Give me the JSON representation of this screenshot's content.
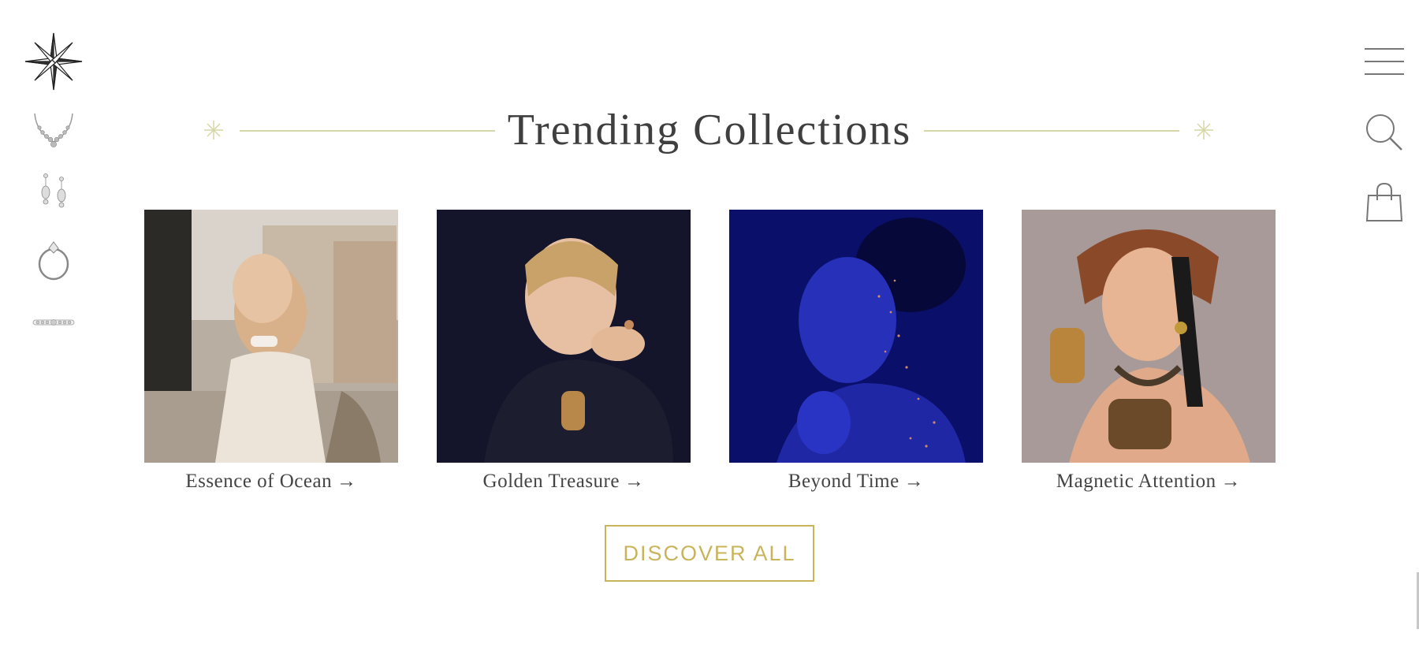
{
  "section": {
    "title": "Trending Collections"
  },
  "sidebar": {
    "logo": "compass-star-logo",
    "categories": [
      {
        "icon": "necklace-icon"
      },
      {
        "icon": "earrings-icon"
      },
      {
        "icon": "ring-icon"
      },
      {
        "icon": "bracelet-icon"
      }
    ]
  },
  "header_actions": {
    "menu_icon": "menu-icon",
    "search_icon": "search-icon",
    "bag_icon": "shopping-bag-icon"
  },
  "collections": [
    {
      "name": "Essence of Ocean",
      "arrow": "→"
    },
    {
      "name": "Golden Treasure",
      "arrow": "→"
    },
    {
      "name": "Beyond Time",
      "arrow": "→"
    },
    {
      "name": "Magnetic Attention",
      "arrow": "→"
    }
  ],
  "cta": {
    "label": "DISCOVER ALL"
  },
  "colors": {
    "accent_gold": "#c9b45c",
    "rule_line": "#d6d6a8",
    "text": "#444444"
  }
}
